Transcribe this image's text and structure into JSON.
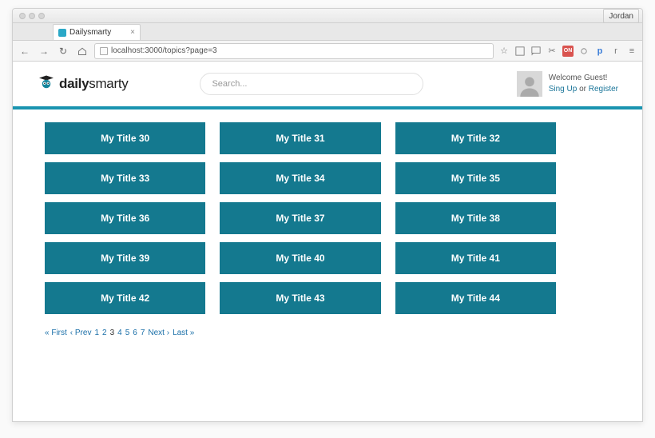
{
  "browser": {
    "user_button": "Jordan",
    "tab_title": "Dailysmarty",
    "url": "localhost:3000/topics?page=3",
    "toolbar_r_label": "r"
  },
  "logo": {
    "prefix": "daily",
    "suffix": "smarty"
  },
  "search": {
    "placeholder": "Search..."
  },
  "welcome": {
    "greeting": "Welcome Guest!",
    "signup": "Sing Up",
    "or": "or",
    "register": "Register"
  },
  "items": [
    "My Title 30",
    "My Title 31",
    "My Title 32",
    "My Title 33",
    "My Title 34",
    "My Title 35",
    "My Title 36",
    "My Title 37",
    "My Title 38",
    "My Title 39",
    "My Title 40",
    "My Title 41",
    "My Title 42",
    "My Title 43",
    "My Title 44"
  ],
  "pagination": {
    "first": "« First",
    "prev": "‹ Prev",
    "pages": [
      "1",
      "2",
      "3",
      "4",
      "5",
      "6",
      "7"
    ],
    "current": "3",
    "next": "Next ›",
    "last": "Last »"
  }
}
